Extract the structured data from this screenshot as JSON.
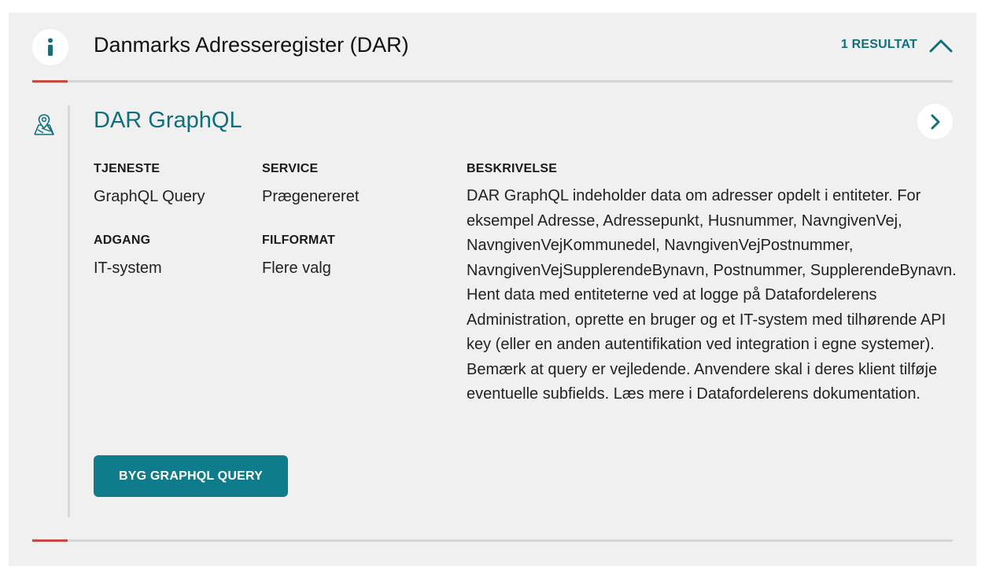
{
  "header": {
    "title": "Danmarks Adresseregister (DAR)",
    "result_count": "1 RESULTAT",
    "icon": "info-icon",
    "collapse_icon": "chevron-up-icon"
  },
  "result": {
    "icon": "map-pin-icon",
    "title": "DAR GraphQL",
    "open_icon": "chevron-right-icon",
    "fields": {
      "tjeneste_label": "TJENESTE",
      "tjeneste_value": "GraphQL Query",
      "service_label": "SERVICE",
      "service_value": "Prægenereret",
      "adgang_label": "ADGANG",
      "adgang_value": "IT-system",
      "filformat_label": "FILFORMAT",
      "filformat_value": "Flere valg",
      "beskrivelse_label": "BESKRIVELSE",
      "beskrivelse_value": "DAR GraphQL indeholder data om adresser opdelt i entiteter. For eksempel Adresse, Adressepunkt, Husnummer, NavngivenVej, NavngivenVejKommunedel, NavngivenVejPostnummer, NavngivenVejSupplerendeBynavn, Postnummer, SupplerendeBynavn. Hent data med entiteterne ved at logge på Datafordelerens Administration, oprette en bruger og et IT-system med tilhørende API key (eller en anden autentifikation ved integration i egne systemer). Bemærk at query er vejledende. Anvendere skal i deres klient tilføje eventuelle subfields. Læs mere i Datafordelerens dokumentation."
    },
    "button_label": "BYG GRAPHQL QUERY"
  },
  "colors": {
    "accent": "#0f6f7c",
    "button": "#0e7c8b",
    "divider_red": "#c8493f",
    "panel_bg": "#f0f0f0"
  }
}
